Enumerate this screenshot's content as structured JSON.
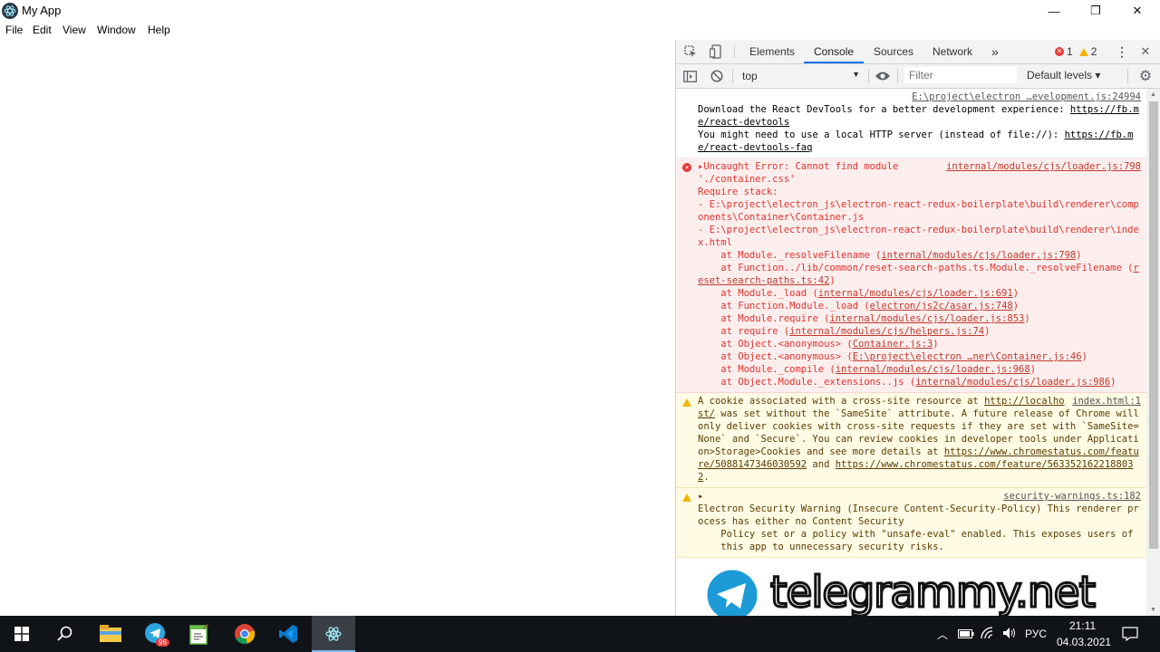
{
  "window": {
    "title": "My App",
    "minimize": "—",
    "maximize": "❐",
    "close": "✕"
  },
  "menu": [
    "File",
    "Edit",
    "View",
    "Window",
    "Help"
  ],
  "devtools": {
    "tabs": [
      "Elements",
      "Console",
      "Sources",
      "Network"
    ],
    "more_tabs": "»",
    "error_count": "1",
    "warning_count": "2",
    "context": "top",
    "filter_placeholder": "Filter",
    "levels": "Default levels ▾"
  },
  "console": {
    "msg1_src": "E:\\project\\electron …evelopment.js:24994",
    "msg1_text1": "Download the React DevTools for a better development experience: ",
    "msg1_link1": "https://fb.me/react-devtools",
    "msg1_text2": "You might need to use a local HTTP server (instead of file://): ",
    "msg1_link2": "https://fb.me/react-devtools-faq",
    "err_src": "internal/modules/cjs/loader.js:798",
    "err_head": "▸Uncaught Error: Cannot find module",
    "err_body": "'./container.css'\nRequire stack:\n- E:\\project\\electron_js\\electron-react-redux-boilerplate\\build\\renderer\\components\\Container\\Container.js\n- E:\\project\\electron_js\\electron-react-redux-boilerplate\\build\\renderer\\index.html",
    "stack": [
      {
        "fn": "    at Module._resolveFilename (",
        "loc": "internal/modules/cjs/loader.js:798",
        "end": ")"
      },
      {
        "fn": "    at Function../lib/common/reset-search-paths.ts.Module._resolveFilename (",
        "loc": "reset-search-paths.ts:42",
        "end": ")"
      },
      {
        "fn": "    at Module._load (",
        "loc": "internal/modules/cjs/loader.js:691",
        "end": ")"
      },
      {
        "fn": "    at Function.Module._load (",
        "loc": "electron/js2c/asar.js:748",
        "end": ")"
      },
      {
        "fn": "    at Module.require (",
        "loc": "internal/modules/cjs/loader.js:853",
        "end": ")"
      },
      {
        "fn": "    at require (",
        "loc": "internal/modules/cjs/helpers.js:74",
        "end": ")"
      },
      {
        "fn": "    at Object.<anonymous> (",
        "loc": "Container.js:3",
        "end": ")"
      },
      {
        "fn": "    at Object.<anonymous> (",
        "loc": "E:\\project\\electron …ner\\Container.js:46",
        "end": ")"
      },
      {
        "fn": "    at Module._compile (",
        "loc": "internal/modules/cjs/loader.js:968",
        "end": ")"
      },
      {
        "fn": "    at Object.Module._extensions..js (",
        "loc": "internal/modules/cjs/loader.js:986",
        "end": ")"
      }
    ],
    "warn1_src": "index.html:1",
    "warn1_a": "A cookie associated with a cross-site resource at ",
    "warn1_link1": "http://localhost/",
    "warn1_b": " was set without the `SameSite` attribute. A future release of Chrome will only deliver cookies with cross-site requests if they are set with `SameSite=None` and `Secure`. You can review cookies in developer tools under Application>Storage>Cookies and see more details at ",
    "warn1_link2": "https://www.chromestatus.com/feature/5088147346030592",
    "warn1_c": " and ",
    "warn1_link3": "https://www.chromestatus.com/feature/5633521622188032",
    "warn1_d": ".",
    "warn2_src": "security-warnings.ts:182",
    "warn2_arrow": "▸",
    "warn2_title": "Electron Security Warning (Insecure Content-Security-Policy)",
    "warn2_body": " This renderer process has either no Content Security\n    Policy set or a policy with \"unsafe-eval\" enabled. This exposes users of\n    this app to unnecessary security risks."
  },
  "taskbar": {
    "telegram_badge": "96",
    "lang": "РУС",
    "time": "21:11",
    "date": "04.03.2021"
  },
  "watermark": "telegrammy.net"
}
